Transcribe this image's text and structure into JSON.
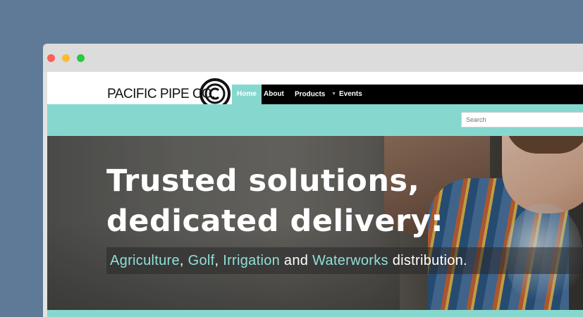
{
  "window": {
    "controls": [
      "close",
      "minimize",
      "maximize"
    ]
  },
  "brand": {
    "name": "PACIFIC PIPE CO.",
    "logo_icon": "pipe-logo-c",
    "colors": {
      "accent": "#86d8cf",
      "nav_bg": "#000000",
      "page_bg": "#5e7a96"
    }
  },
  "nav": {
    "items": [
      {
        "label": "Home",
        "active": true
      },
      {
        "label": "About",
        "active": false
      },
      {
        "label": "Products",
        "active": false,
        "has_dropdown": true
      },
      {
        "label": "Events",
        "active": false
      }
    ]
  },
  "search": {
    "placeholder": "Search",
    "value": ""
  },
  "hero": {
    "headline_line1": "Trusted solutions,",
    "headline_line2": "dedicated delivery:",
    "sub": {
      "item1": "Agriculture",
      "sep1": ", ",
      "item2": "Golf",
      "sep2": ", ",
      "item3": "Irrigation",
      "and": " and ",
      "item4": "Waterworks",
      "tail": " distribution."
    }
  }
}
